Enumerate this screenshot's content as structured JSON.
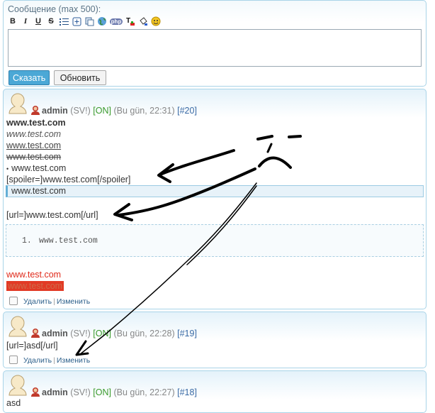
{
  "compose": {
    "label": "Сообщение (max 500):",
    "toolbar": [
      "bold-icon",
      "italic-icon",
      "underline-icon",
      "strike-icon",
      "list-icon",
      "insert-icon",
      "copy-icon",
      "globe-icon",
      "php-icon",
      "text-color-icon",
      "fill-icon",
      "smiley-icon"
    ],
    "toolbar_glyphs": {
      "bold": "B",
      "italic": "I",
      "underline": "U",
      "strike": "S",
      "php": "php"
    },
    "message_value": "",
    "say_label": "Сказать",
    "refresh_label": "Обновить"
  },
  "posts": [
    {
      "user": "admin",
      "role": "(SV!)",
      "status": "[ON]",
      "date": "(Bu gün, 22:31)",
      "id": "[#20]",
      "lines": {
        "bold": "www.test.com",
        "italic": "www.test.com",
        "underline": "www.test.com",
        "strike": "www.test.com",
        "list_item": "www.test.com",
        "spoiler": "[spoiler=]www.test.com[/spoiler]",
        "quote": "www.test.com",
        "url": "[url=]www.test.com[/url]",
        "code_num": "1.",
        "code_text": "www.test.com",
        "red": "www.test.com",
        "red_bg": "www.test.com"
      }
    },
    {
      "user": "admin",
      "role": "(SV!)",
      "status": "[ON]",
      "date": "(Bu gün, 22:28)",
      "id": "[#19]",
      "lines": {
        "text": "[url=]asd[/url]"
      }
    },
    {
      "user": "admin",
      "role": "(SV!)",
      "status": "[ON]",
      "date": "(Bu gün, 22:27)",
      "id": "[#18]",
      "lines": {
        "text": "asd"
      }
    }
  ],
  "actions": {
    "delete": "Удалить",
    "edit": "Изменить",
    "separator": "|"
  },
  "colors": {
    "accent": "#4ba8d6",
    "panel_border": "#a9d4e8",
    "online": "#3a9a2b",
    "post_id": "#3a6aa5",
    "red_text": "#e02a1a",
    "red_bg": "#e23a25"
  }
}
